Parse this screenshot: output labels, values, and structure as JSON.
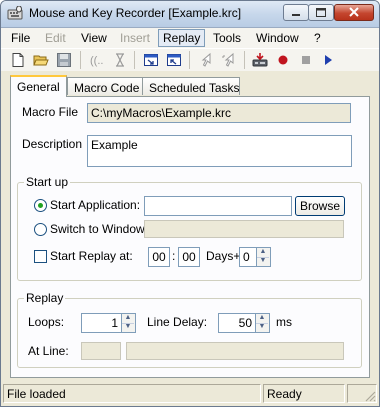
{
  "window": {
    "title": "Mouse and Key Recorder  [Example.krc]"
  },
  "menu": [
    {
      "label": "File",
      "state": "normal"
    },
    {
      "label": "Edit",
      "state": "disabled"
    },
    {
      "label": "View",
      "state": "normal"
    },
    {
      "label": "Insert",
      "state": "disabled"
    },
    {
      "label": "Replay",
      "state": "active"
    },
    {
      "label": "Tools",
      "state": "normal"
    },
    {
      "label": "Window",
      "state": "normal"
    },
    {
      "label": "?",
      "state": "normal"
    }
  ],
  "toolbar": {
    "icons": [
      "new-file-icon",
      "open-folder-icon",
      "save-icon",
      "delay-marker-icon",
      "hourglass-icon",
      "import-window-icon",
      "export-window-icon",
      "cursor-arrow-icon",
      "cursor-select-icon",
      "replay-machine-icon",
      "record-icon",
      "stop-icon",
      "play-icon"
    ],
    "colors": {
      "record": "#c0141e",
      "play": "#1f3fae"
    }
  },
  "tabs": [
    {
      "label": "General",
      "selected": true
    },
    {
      "label": "Macro Code",
      "selected": false
    },
    {
      "label": "Scheduled Tasks",
      "selected": false
    }
  ],
  "general": {
    "macro_file_label": "Macro File",
    "macro_file_value": "C:\\myMacros\\Example.krc",
    "description_label": "Description",
    "description_value": "Example"
  },
  "startup": {
    "group_label": "Start up",
    "start_application_label": "Start Application:",
    "start_application_selected": true,
    "start_application_value": "",
    "browse_label": "Browse",
    "switch_window_label": "Switch to Window:",
    "switch_window_value": "",
    "start_replay_label": "Start Replay at:",
    "start_replay_checked": false,
    "hour": "00",
    "minute": "00",
    "days_label": "Days+",
    "days_value": "0"
  },
  "replay": {
    "group_label": "Replay",
    "loops_label": "Loops:",
    "loops_value": "1",
    "line_delay_label": "Line Delay:",
    "line_delay_value": "50",
    "line_delay_unit": "ms",
    "at_line_label": "At Line:",
    "at_line_value": "",
    "at_line_text": ""
  },
  "status": {
    "left": "File loaded",
    "right": "Ready"
  }
}
